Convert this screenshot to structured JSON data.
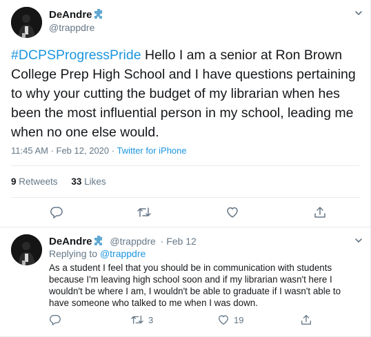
{
  "main_tweet": {
    "display_name": "DeAndre",
    "handle": "@trappdre",
    "hashtag": "#DCPSProgressPride",
    "body": " Hello I am a senior at Ron Brown College Prep High School and I have questions pertaining to why your cutting the budget of my librarian when hes been the most influential person in my school, leading me when no one else would.",
    "timestamp": "11:45 AM · Feb 12, 2020",
    "separator": " · ",
    "source": "Twitter for iPhone",
    "retweets_count": "9",
    "retweets_label": "Retweets",
    "likes_count": "33",
    "likes_label": "Likes"
  },
  "reply_tweet": {
    "display_name": "DeAndre",
    "handle": "@trappdre",
    "date": "· Feb 12",
    "replying_to_label": "Replying to ",
    "replying_to_handle": "@trappdre",
    "body": "As a student I feel that you should be in communication with students because I'm leaving high school soon and if my librarian wasn't here I wouldn't be where I am, I wouldn't be able to graduate if I wasn't able to have someone who talked to me when I was down.",
    "retweets_count": "3",
    "likes_count": "19"
  },
  "colors": {
    "accent": "#1b95e0",
    "secondary_text": "#657786",
    "divider": "#e6ecf0",
    "badge": "#5fa8d3"
  },
  "icons": [
    "avatar",
    "puzzle-badge-icon",
    "chevron-down-icon",
    "reply-icon",
    "retweet-icon",
    "like-icon",
    "share-icon"
  ]
}
